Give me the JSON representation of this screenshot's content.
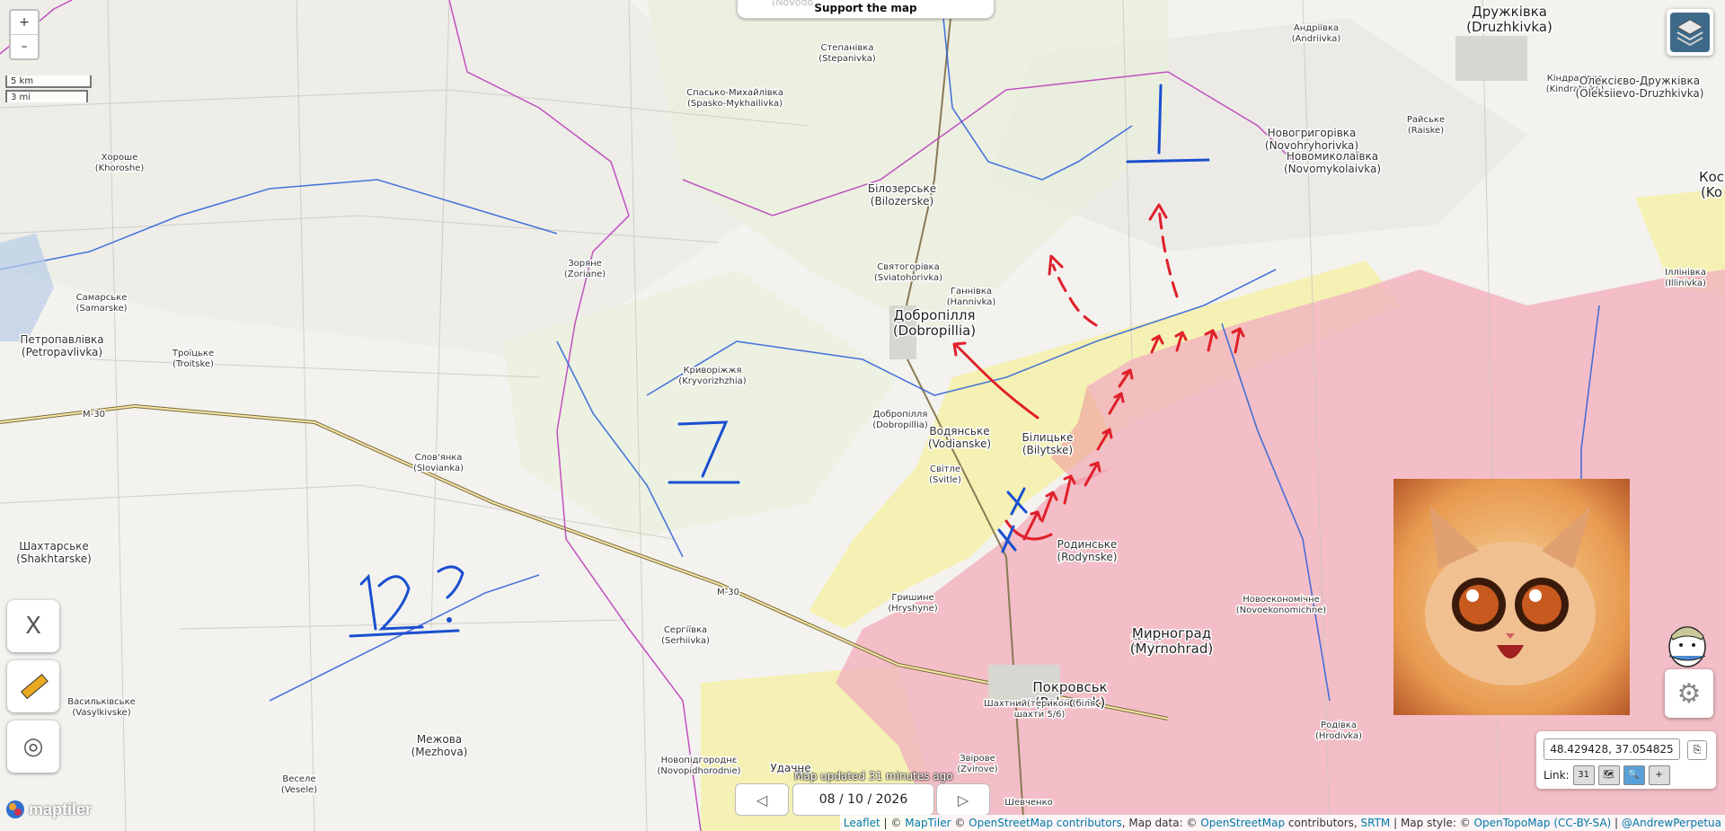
{
  "map": {
    "zoom_in": "+",
    "zoom_out": "–",
    "scale_km": "5 km",
    "scale_mi": "3 mi",
    "support_ghost": "(Novodo...",
    "support_label": "Support the map",
    "annotations": [
      "1",
      "7",
      "12?"
    ],
    "places": [
      {
        "name": "Дружківка",
        "sub": "(Druzhkivka)"
      },
      {
        "name": "Андріївка",
        "sub": "(Andriivka)"
      },
      {
        "name": "Степанівка",
        "sub": "(Stepanivka)"
      },
      {
        "name": "Спасько-Михайлівка",
        "sub": "(Spasko-Mykhailivka)"
      },
      {
        "name": "Новогригорівка",
        "sub": "(Novohryhorivka)"
      },
      {
        "name": "Новомиколаївка",
        "sub": "(Novomykolaivka)"
      },
      {
        "name": "Райське",
        "sub": "(Raiske)"
      },
      {
        "name": "Кіндратівка",
        "sub": "(Kindrativka)"
      },
      {
        "name": "Олексієво-Дружківка",
        "sub": "(Oleksiievo-Druzhkivka)"
      },
      {
        "name": "Хороше",
        "sub": "(Khoroshe)"
      },
      {
        "name": "Білозерське",
        "sub": "(Bilozerske)"
      },
      {
        "name": "Зоряне",
        "sub": "(Zoriane)"
      },
      {
        "name": "Святогорівка",
        "sub": "(Sviatohorivka)"
      },
      {
        "name": "Ганнівка",
        "sub": "(Hannivka)"
      },
      {
        "name": "Добропілля",
        "sub": "(Dobropillia)"
      },
      {
        "name": "Самарське",
        "sub": "(Samarske)"
      },
      {
        "name": "Петропавлівка",
        "sub": "(Petropavlivka)"
      },
      {
        "name": "Троїцьке",
        "sub": "(Troitske)"
      },
      {
        "name": "Криворіжжя",
        "sub": "(Kryvorizhzhia)"
      },
      {
        "name": "Добропілля",
        "sub": "(Dobropillia)"
      },
      {
        "name": "Водянське",
        "sub": "(Vodianske)"
      },
      {
        "name": "Білицьке",
        "sub": "(Bilytske)"
      },
      {
        "name": "Світле",
        "sub": "(Svitle)"
      },
      {
        "name": "Слов'янка",
        "sub": "(Slovianka)"
      },
      {
        "name": "Шахтарське",
        "sub": "(Shakhtarske)"
      },
      {
        "name": "Родинське",
        "sub": "(Rodynske)"
      },
      {
        "name": "Гришине",
        "sub": "(Hryshyne)"
      },
      {
        "name": "Новоекономічне",
        "sub": "(Novoekonomichne)"
      },
      {
        "name": "Сергіївка",
        "sub": "(Serhiivka)"
      },
      {
        "name": "Світле",
        "sub": "(Svitle)"
      },
      {
        "name": "Мирноград",
        "sub": "(Myrnohrad)"
      },
      {
        "name": "Покровськ",
        "sub": "(Pokrovsk)"
      },
      {
        "name": "Васильківське",
        "sub": "(Vasylkivske)"
      },
      {
        "name": "Межова",
        "sub": "(Mezhova)"
      },
      {
        "name": "Веселе",
        "sub": "(Vesele)"
      },
      {
        "name": "Новопідгороднє",
        "sub": "(Novopidhorodnie)"
      },
      {
        "name": "Удачне",
        "sub": ""
      },
      {
        "name": "Звірове",
        "sub": "(Zvirove)"
      },
      {
        "name": "Шевченко",
        "sub": ""
      },
      {
        "name": "Родівка",
        "sub": "(Hrodivka)"
      },
      {
        "name": "Шахтний(терикон (біля",
        "sub": "шахти 5/6)"
      },
      {
        "name": "Іллінівка",
        "sub": "(Illinivka)"
      },
      {
        "name": "Кос",
        "sub": "(Ko"
      }
    ],
    "roads": [
      "M-30",
      "M-30"
    ]
  },
  "controls": {
    "x_label": "X",
    "ruler_icon": "ruler-icon",
    "target_icon": "target-icon",
    "settings_icon": "gear-icon",
    "layers_icon": "layers-icon",
    "logo_text": "maptiler"
  },
  "coords": {
    "value": "48.429428, 37.054825",
    "copy_label": "⎘",
    "link_label": "Link:",
    "link_cal": "31"
  },
  "timeline": {
    "updated_text": "Map updated 31 minutes ago",
    "date_value": "08 / 10 / 2026",
    "prev": "◁",
    "next": "▷"
  },
  "attribution": {
    "leaflet": "Leaflet",
    "sep1": " | © ",
    "maptiler": "MapTiler",
    "sep2": " © ",
    "osm": "OpenStreetMap contributors",
    "mapdata": ", Map data: © ",
    "osm2": "OpenStreetMap",
    "contrib": " contributors, ",
    "srtm": "SRTM",
    "mapstyle": " | Map style: © ",
    "opentopo": "OpenTopoMap",
    "ccbysa": "(CC-BY-SA)",
    "sep3": " | ",
    "author": "@AndrewPerpetua"
  },
  "colors": {
    "occupied": "#f2b5c0",
    "contested": "#f5f0a0",
    "border": "#c050c0",
    "river": "#2a5fd8",
    "arrow": "#e0202a",
    "annotation": "#1a4fd0"
  }
}
